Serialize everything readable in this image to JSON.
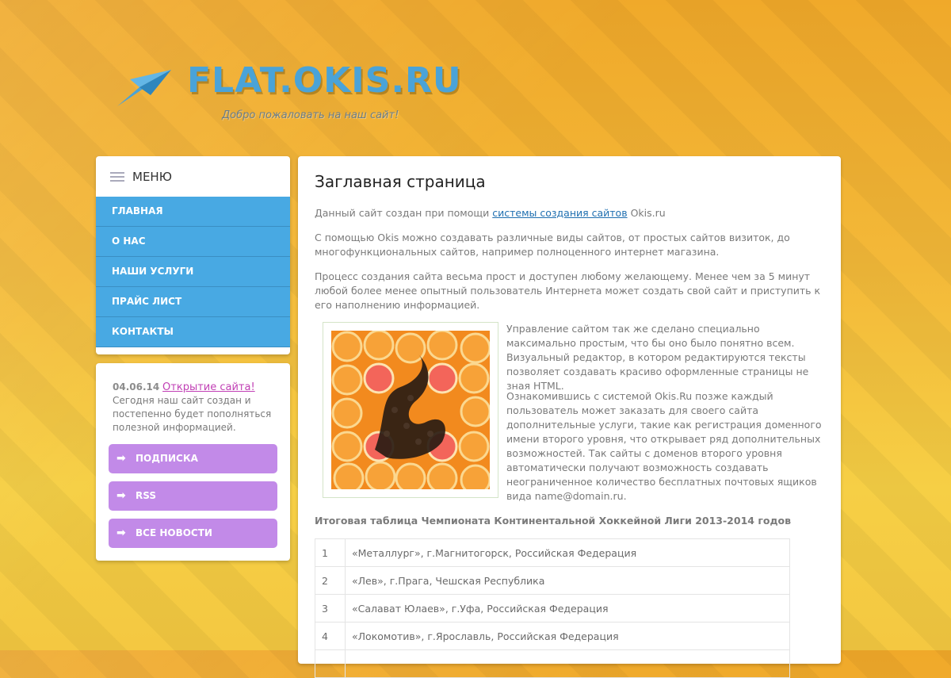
{
  "header": {
    "site_name": "FLAT.OKIS.RU",
    "slogan": "Добро пожаловать на наш сайт!"
  },
  "menu": {
    "title": "МЕНЮ",
    "items": [
      "ГЛАВНАЯ",
      "О НАС",
      "НАШИ УСЛУГИ",
      "ПРАЙС ЛИСТ",
      "КОНТАКТЫ"
    ]
  },
  "news": {
    "date": "04.06.14",
    "link": "Открытие сайта!",
    "text": "Сегодня наш сайт создан и постепенно будет пополняться полезной информацией.",
    "buttons": [
      "ПОДПИСКА",
      "RSS",
      "ВСЕ НОВОСТИ"
    ]
  },
  "content": {
    "title": "Заглавная страница",
    "p1_before": "Данный сайт создан при помощи",
    "p1_link": "системы создания сайтов",
    "p1_after": "Okis.ru",
    "p2": "С помощью Okis можно создавать различные виды сайтов, от простых сайтов визиток, до многофункциональных сайтов, например полноценного интернет магазина.",
    "p3": "Процесс создания сайта весьма прост и доступен любому желающему. Менее чем за 5 минут любой более менее опытный пользователь Интернета может создать свой сайт и приступить к его наполнению информацией.",
    "p4": "Управление сайтом так же сделано специально максимально простым, что бы оно было понятно всем. Визуальный редактор, в котором редактируются тексты позволяет создавать красиво оформленные страницы не зная HTML.",
    "p5": "Ознакомившись с системой Okis.Ru позже каждый пользователь может заказать для своего сайта дополнительные услуги, такие как регистрация доменного имени второго уровня, что открывает ряд дополнительных возможностей. Так сайты с доменов второго уровня автоматически получают возможность создавать неограниченное количество бесплатных почтовых ящиков вида name@domain.ru.",
    "table_title": "Итоговая таблица Чемпионата Континентальной Хоккейной Лиги 2013-2014 годов",
    "table_rows": [
      {
        "n": "1",
        "team": "«Металлург», г.Магнитогорск, Российская Федерация"
      },
      {
        "n": "2",
        "team": "«Лев», г.Прага, Чешская Республика"
      },
      {
        "n": "3",
        "team": "«Салават Юлаев», г.Уфа, Российская Федерация"
      },
      {
        "n": "4",
        "team": "«Локомотив», г.Ярославль, Российская Федерация"
      },
      {
        "n": "",
        "team": ""
      }
    ]
  },
  "colors": {
    "menu_blue": "#48a9e3",
    "button_purple": "#c28ae8",
    "link_pink": "#c140b5",
    "logo_blue": "#4aa3d8"
  },
  "icons": [
    "paper-plane-logo-icon",
    "menu-list-icon",
    "arrow-right-icon"
  ]
}
